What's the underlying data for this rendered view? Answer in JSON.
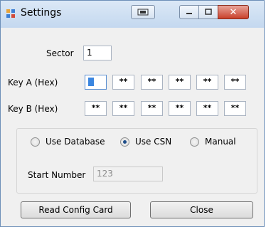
{
  "window": {
    "title": "Settings"
  },
  "form": {
    "sector_label": "Sector",
    "sector_value": "1",
    "key_a_label": "Key A (Hex)",
    "key_b_label": "Key B (Hex)",
    "key_a": [
      "",
      "**",
      "**",
      "**",
      "**",
      "**"
    ],
    "key_b": [
      "**",
      "**",
      "**",
      "**",
      "**",
      "**"
    ]
  },
  "options": {
    "use_database": "Use Database",
    "use_csn": "Use CSN",
    "manual": "Manual",
    "selected": "Use CSN"
  },
  "start": {
    "label": "Start Number",
    "value": "123"
  },
  "buttons": {
    "read": "Read Config Card",
    "close": "Close"
  },
  "colors": {
    "title_bar": "#c4d8ef",
    "close_button": "#c9402b",
    "focus_caret": "#3b86e0"
  }
}
